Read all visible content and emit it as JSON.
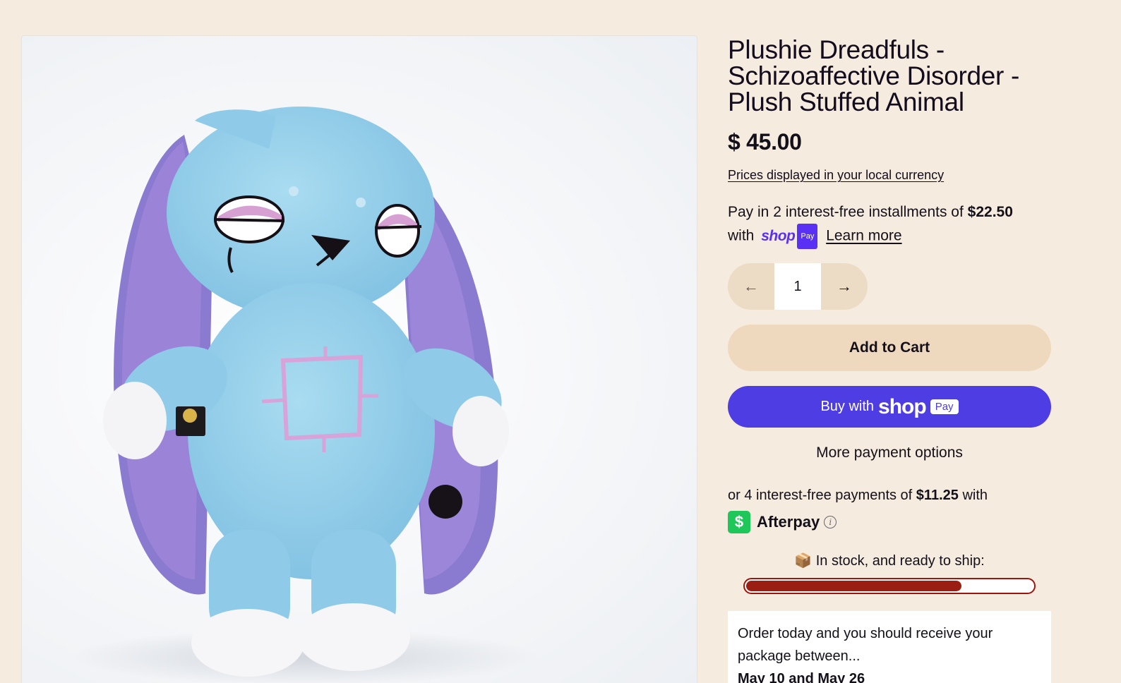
{
  "product": {
    "title": "Plushie Dreadfuls - Schizoaffective Disorder - Plush Stuffed Animal",
    "price": "$ 45.00",
    "currency_note": "Prices displayed in your local currency",
    "image_alt": "Blue bunny plush with purple ears"
  },
  "shop_pay": {
    "installments_text": "Pay in 2 interest-free installments of",
    "installment_amount": "$22.50",
    "with": "with",
    "logo_word": "shop",
    "logo_badge": "Pay",
    "learn_more": "Learn more"
  },
  "quantity": {
    "value": "1",
    "decrement_icon": "arrow-left-icon",
    "increment_icon": "arrow-right-icon"
  },
  "buttons": {
    "add_to_cart": "Add to Cart",
    "buy_with": "Buy with",
    "buy_shop": "shop",
    "buy_pay": "Pay",
    "more_options": "More payment options"
  },
  "afterpay": {
    "text_before": "or 4 interest-free payments of",
    "amount": "$11.25",
    "text_after": "with",
    "icon_glyph": "$",
    "name": "Afterpay",
    "info_glyph": "i"
  },
  "stock": {
    "emoji": "📦",
    "label": "In stock, and ready to ship:",
    "level": 0.75
  },
  "delivery": {
    "text": "Order today and you should receive your package between...",
    "dates": "May 10 and May 26"
  },
  "colors": {
    "background": "#f5ebde",
    "shop_pay": "#4d3de3",
    "stock_fill": "#9a1f12",
    "afterpay_green": "#1fc65a"
  }
}
